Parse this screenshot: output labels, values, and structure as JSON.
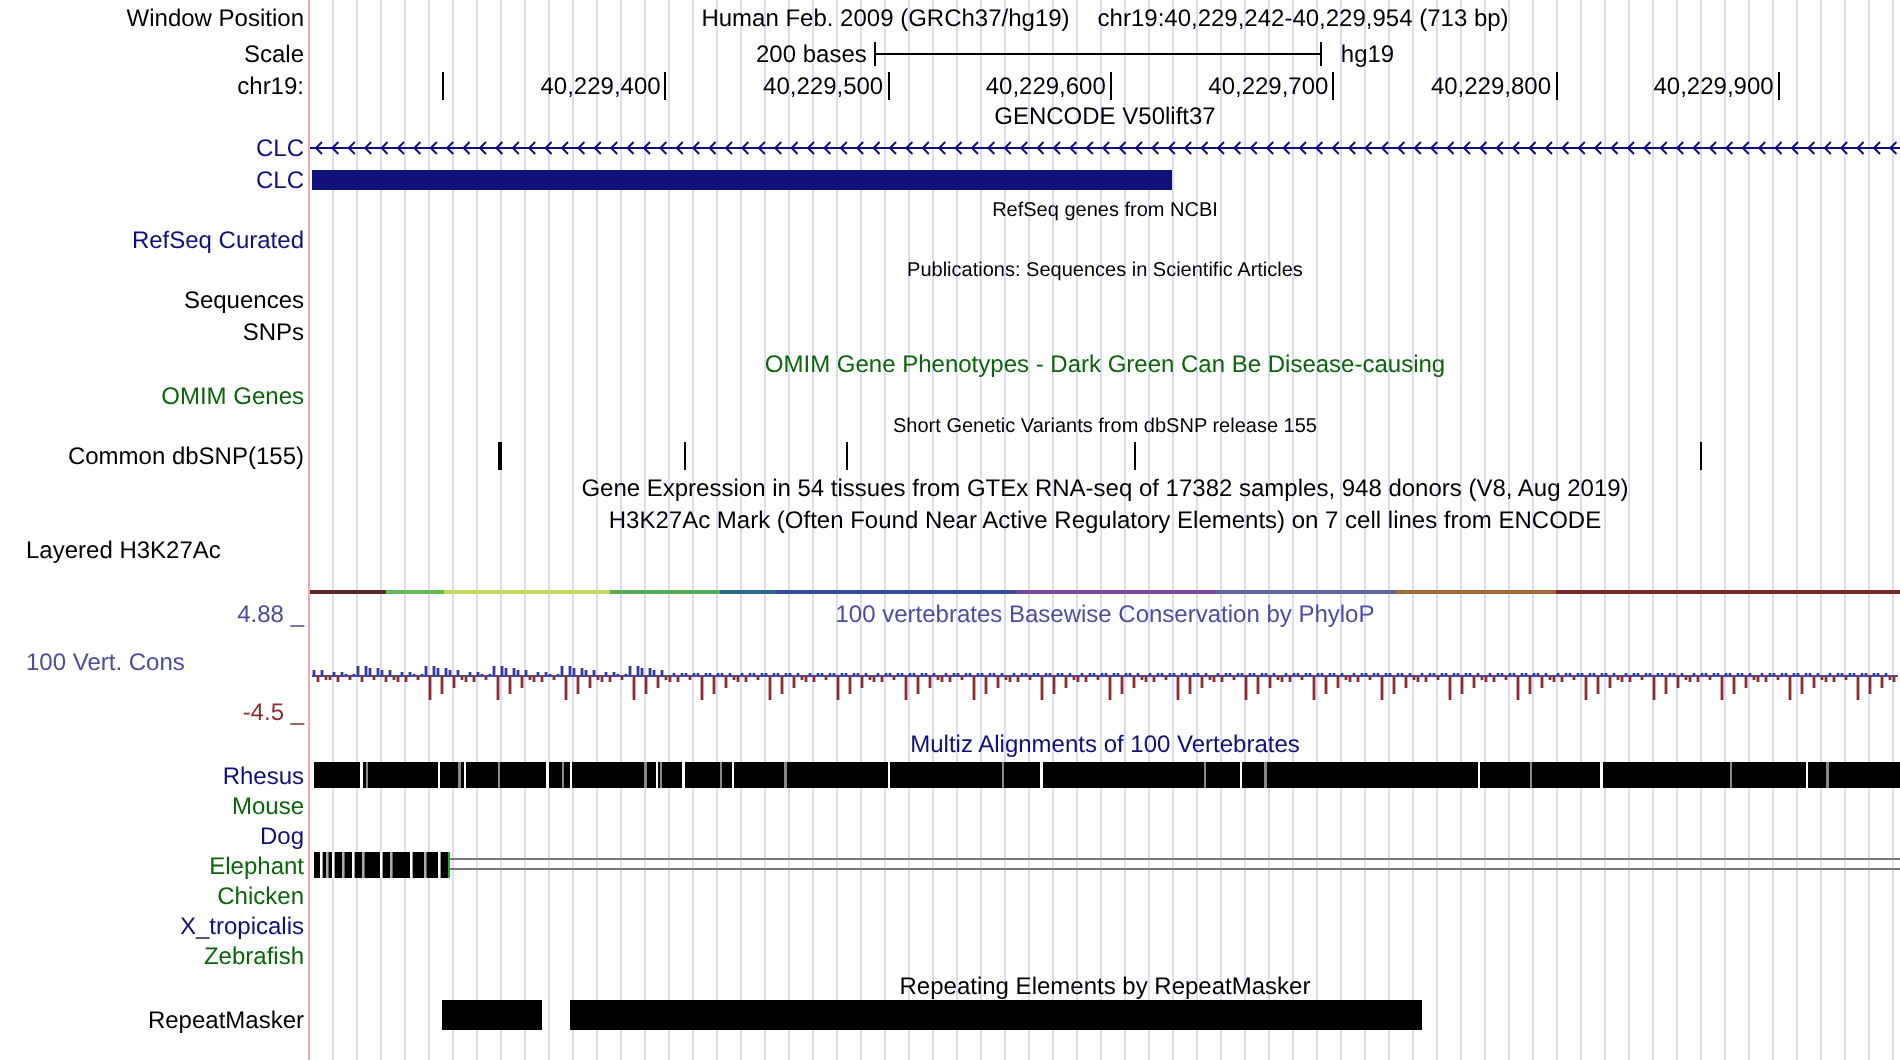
{
  "header": {
    "window_label": "Window Position",
    "assembly": "Human Feb. 2009 (GRCh37/hg19)",
    "position": "chr19:40,229,242-40,229,954 (713 bp)",
    "scale_label": "Scale",
    "scale_text": "200 bases",
    "scale_assembly": "hg19",
    "chrom_label": "chr19:",
    "ticks": [
      "40,229,400",
      "40,229,500",
      "40,229,600",
      "40,229,700",
      "40,229,800",
      "40,229,900"
    ]
  },
  "rows": [
    {
      "kind": "title",
      "small": false,
      "title": "GENCODE V50lift37"
    },
    {
      "kind": "gene_line",
      "label": "CLC",
      "color": "#10107a"
    },
    {
      "kind": "gene_block",
      "label": "CLC",
      "color": "#10107a"
    },
    {
      "kind": "title",
      "small": true,
      "title": "RefSeq genes from NCBI"
    },
    {
      "kind": "label",
      "label": "RefSeq Curated",
      "color": "#10107a"
    },
    {
      "kind": "title",
      "small": true,
      "title": "Publications: Sequences in Scientific Articles"
    },
    {
      "kind": "label",
      "label": "Sequences"
    },
    {
      "kind": "label",
      "label": "SNPs"
    },
    {
      "kind": "title",
      "small": false,
      "title": "OMIM Gene Phenotypes - Dark Green Can Be Disease-causing",
      "color": "#0b640b"
    },
    {
      "kind": "label",
      "label": "OMIM Genes",
      "color": "#0b640b"
    },
    {
      "kind": "title",
      "small": true,
      "title": "Short Genetic Variants from dbSNP release 155"
    },
    {
      "kind": "snp_ticks",
      "label": "Common dbSNP(155)"
    },
    {
      "kind": "title",
      "small": false,
      "title": "Gene Expression in 54 tissues from GTEx RNA-seq of 17382 samples, 948 donors (V8, Aug 2019)"
    },
    {
      "kind": "title",
      "small": false,
      "title": "H3K27Ac Mark (Often Found Near Active Regulatory Elements) on 7 cell lines from ENCODE"
    },
    {
      "kind": "layered",
      "label": "Layered H3K27Ac"
    },
    {
      "kind": "conservation",
      "max": "4.88 _",
      "label": "100 Vert. Cons",
      "min": "-4.5 _",
      "title": "100 vertebrates Basewise Conservation by PhyloP",
      "color": "#4d4d9e"
    },
    {
      "kind": "title",
      "small": false,
      "title": "Multiz Alignments of 100 Vertebrates",
      "color": "#10107a"
    },
    {
      "kind": "species_full",
      "label": "Rhesus",
      "color": "#10107a"
    },
    {
      "kind": "species_empty",
      "label": "Mouse",
      "color": "#0b640b"
    },
    {
      "kind": "species_empty",
      "label": "Dog",
      "color": "#10107a"
    },
    {
      "kind": "species_partial",
      "label": "Elephant",
      "color": "#0b640b"
    },
    {
      "kind": "species_empty",
      "label": "Chicken",
      "color": "#0b640b"
    },
    {
      "kind": "species_empty",
      "label": "X_tropicalis",
      "color": "#10107a"
    },
    {
      "kind": "species_empty",
      "label": "Zebrafish",
      "color": "#0b640b"
    },
    {
      "kind": "title",
      "small": false,
      "title": "Repeating Elements by RepeatMasker"
    },
    {
      "kind": "repeats",
      "label": "RepeatMasker"
    }
  ]
}
